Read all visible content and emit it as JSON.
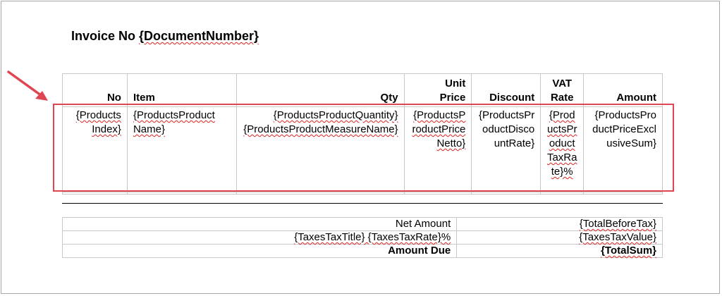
{
  "document": {
    "title_prefix": "Invoice No ",
    "title_field": "{DocumentNumber}"
  },
  "items_table": {
    "headers": {
      "no": "No",
      "item": "Item",
      "qty": "Qty",
      "unit_price_1": "Unit",
      "unit_price_2": "Price",
      "discount": "Discount",
      "vat_1": "VAT",
      "vat_2": "Rate",
      "amount": "Amount"
    },
    "row": {
      "no": "{Products Index}",
      "item": "{ProductsProduct Name}",
      "qty_1": "{ProductsProductQuantity}",
      "qty_2": "{ProductsProductMeasureName}",
      "unit_price": "{ProductsProductPriceNetto}",
      "discount": "{ProductsProductDiscountRate}",
      "vat": "{ProductsProductTaxRate}%",
      "amount": "{ProductsProductPriceExclusiveSum}"
    }
  },
  "totals": {
    "net_label": "Net Amount",
    "net_value": "{TotalBeforeTax}",
    "tax_label": "{TaxesTaxTitle} {TaxesTaxRate}%",
    "tax_value": "{TaxesTaxValue}",
    "due_label": "Amount Due",
    "due_value": "{TotalSum}"
  },
  "annotation": {
    "highlight_color": "#e04652",
    "arrow_color": "#e04652"
  }
}
